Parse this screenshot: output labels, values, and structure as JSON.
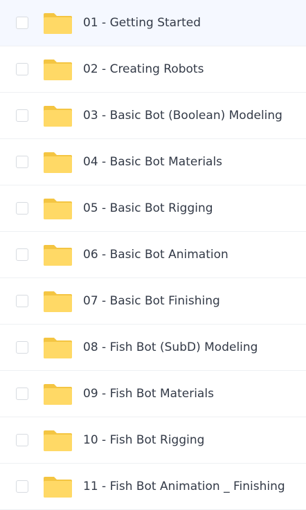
{
  "colors": {
    "folder": "#ffd966",
    "folder_tab": "#f4c542",
    "text": "#333a47",
    "divider": "#eef0f3",
    "checkbox_border": "#d7dbe0"
  },
  "rows": [
    {
      "name": "01 - Getting Started",
      "icon": "folder-icon",
      "checked": false
    },
    {
      "name": "02 - Creating Robots",
      "icon": "folder-icon",
      "checked": false
    },
    {
      "name": "03 - Basic Bot (Boolean) Modeling",
      "icon": "folder-icon",
      "checked": false
    },
    {
      "name": "04 - Basic Bot Materials",
      "icon": "folder-icon",
      "checked": false
    },
    {
      "name": "05 - Basic Bot Rigging",
      "icon": "folder-icon",
      "checked": false
    },
    {
      "name": "06 - Basic Bot Animation",
      "icon": "folder-icon",
      "checked": false
    },
    {
      "name": "07 - Basic Bot Finishing",
      "icon": "folder-icon",
      "checked": false
    },
    {
      "name": "08 - Fish Bot (SubD) Modeling",
      "icon": "folder-icon",
      "checked": false
    },
    {
      "name": "09 - Fish Bot Materials",
      "icon": "folder-icon",
      "checked": false
    },
    {
      "name": "10 - Fish Bot Rigging",
      "icon": "folder-icon",
      "checked": false
    },
    {
      "name": "11 - Fish Bot Animation _ Finishing",
      "icon": "folder-icon",
      "checked": false
    }
  ]
}
